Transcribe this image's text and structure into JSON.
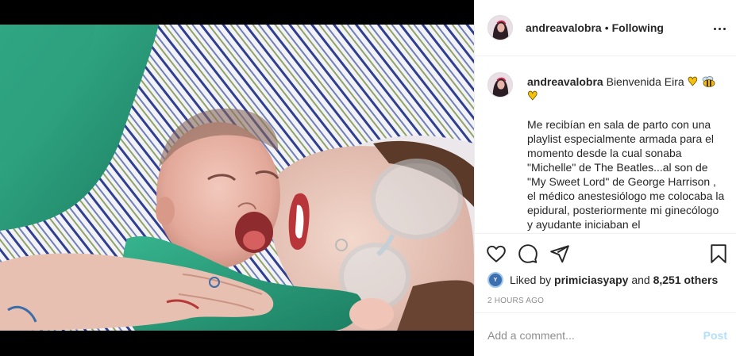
{
  "post": {
    "username": "andreavalobra",
    "dot": "•",
    "follow_state": "Following",
    "more_icon": "ellipsis-icon"
  },
  "caption": {
    "username": "andreavalobra",
    "intro": "Bienvenida Eira",
    "emojis": [
      "yellow-heart",
      "honeybee",
      "yellow-heart"
    ],
    "text": "Me recibían en sala de parto con una playlist especialmente armada para el momento desde la cual sonaba \"Michelle\" de The Beatles...al son de \"My Sweet Lord\" de George Harrison , el médico anestesiólogo me colocaba la epidural, posteriormente mi ginecólogo y ayudante iniciaban el"
  },
  "actions": {
    "like_icon": "heart-icon",
    "comment_icon": "comment-icon",
    "share_icon": "paper-plane-icon",
    "save_icon": "bookmark-icon"
  },
  "likes": {
    "prefix": "Liked by",
    "first_user": "primiciasyapy",
    "joiner": "and",
    "others": "8,251 others"
  },
  "timestamp": "2 HOURS AGO",
  "comment_box": {
    "placeholder": "Add a comment...",
    "post_label": "Post"
  },
  "colors": {
    "text": "#262626",
    "muted": "#8e8e8e",
    "post_disabled": "#b2dffc",
    "divider": "#efefef"
  }
}
